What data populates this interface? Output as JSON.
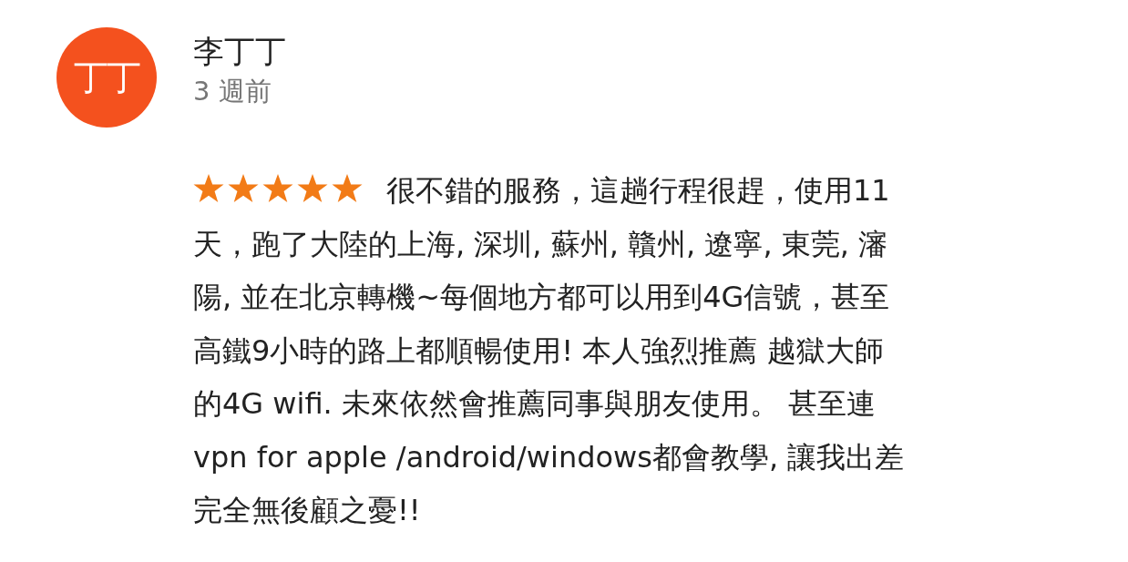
{
  "review": {
    "avatar_text": "丁丁",
    "author": "李丁丁",
    "time": "3 週前",
    "stars": 5,
    "lines": [
      "很不錯的服務，這趟行程很趕，使用11",
      "天，跑了大陸的上海, 深圳, 蘇州, 贛州, 遼寧, 東莞, 瀋",
      "陽, 並在北京轉機~每個地方都可以用到4G信號，甚至",
      "高鐵9小時的路上都順暢使用! 本人強烈推薦 越獄大師",
      "的4G wifi. 未來依然會推薦同事與朋友使用。 甚至連",
      "vpn for apple /android/windows都會教學, 讓我出差",
      "完全無後顧之憂!!"
    ]
  }
}
